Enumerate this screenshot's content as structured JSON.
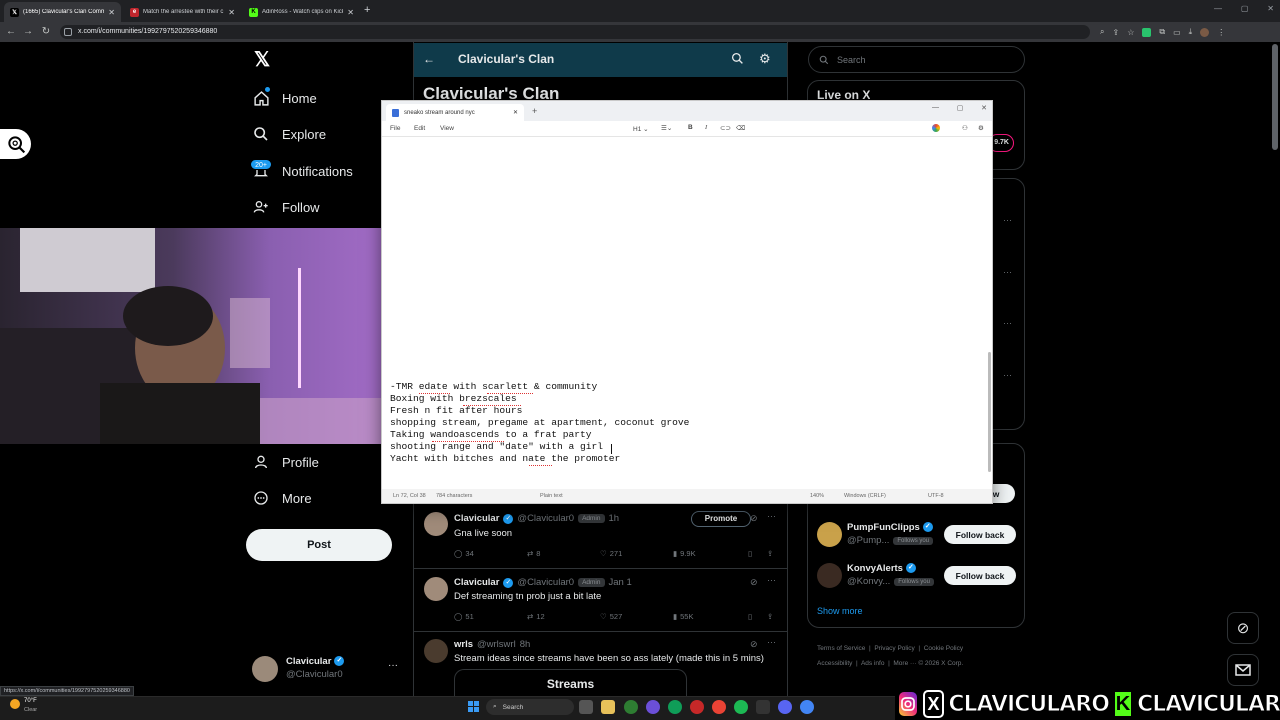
{
  "browser": {
    "tabs": [
      {
        "title": "(1665) Clavicular's Clan Commu",
        "icon": "X"
      },
      {
        "title": "Match the arrestee with their c",
        "icon": "e"
      },
      {
        "title": "AdinRoss - Watch clips on Kick",
        "icon": "K"
      }
    ],
    "url": "x.com/i/communities/1992797520259346880",
    "status_url": "https://x.com/i/communities/1992797520259346880"
  },
  "x_nav": {
    "items": [
      {
        "label": "Home",
        "icon": "home-icon"
      },
      {
        "label": "Explore",
        "icon": "search-icon"
      },
      {
        "label": "Notifications",
        "icon": "bell-icon",
        "badge": "20+"
      },
      {
        "label": "Follow",
        "icon": "follow-icon"
      },
      {
        "label": "Profile",
        "icon": "profile-icon"
      },
      {
        "label": "More",
        "icon": "more-icon"
      }
    ],
    "post_button": "Post",
    "account_name": "Clavicular",
    "account_handle": "@Clavicular0"
  },
  "community": {
    "header_title": "Clavicular's Clan",
    "big_title": "Clavicular's Clan"
  },
  "notepad": {
    "tab_title": "sneako stream around nyc",
    "menu": [
      "File",
      "Edit",
      "View"
    ],
    "heading_select": "H1",
    "lines": [
      "-TMR edate with scarlett & community",
      "Boxing with brezscales",
      "Fresh n fit after hours",
      "shopping stream, pregame at apartment, coconut grove",
      "Taking wandoascends to a frat party",
      "shooting range and \"date\" with a girl",
      "Yacht with bitches and nate the promoter"
    ],
    "status": {
      "position": "Ln 72, Col 38",
      "chars": "784 characters",
      "format": "Plain text",
      "zoom": "140%",
      "line_ending": "Windows (CRLF)",
      "encoding": "UTF-8"
    }
  },
  "posts": [
    {
      "name": "Clavicular",
      "handle": "@Clavicular0",
      "badge": "Admin",
      "time": "1h",
      "text": "Gna live soon",
      "replies": "34",
      "reposts": "8",
      "likes": "271",
      "views": "9.9K",
      "promote": "Promote"
    },
    {
      "name": "Clavicular",
      "handle": "@Clavicular0",
      "badge": "Admin",
      "time": "Jan 1",
      "text": "Def streaming tn prob just a bit late",
      "replies": "51",
      "reposts": "12",
      "likes": "527",
      "views": "55K"
    },
    {
      "name": "wrls",
      "handle": "@wrlswrl",
      "time": "8h",
      "text": "Stream ideas since streams have been so ass lately (made this in 5 mins)",
      "card_title": "Streams"
    }
  ],
  "right": {
    "search_placeholder": "Search",
    "live_title": "Live on X",
    "live_count": "9.7K",
    "follow_partial": "ow",
    "who_to_follow": [
      {
        "name": "PumpFunClipps",
        "handle": "@Pump...",
        "follows": "Follows you",
        "button": "Follow back"
      },
      {
        "name": "KonvyAlerts",
        "handle": "@Konvy...",
        "follows": "Follows you",
        "button": "Follow back"
      }
    ],
    "show_more": "Show more",
    "footer": [
      "Terms of Service",
      "Privacy Policy",
      "Cookie Policy",
      "Accessibility",
      "Ads info",
      "More ···",
      "© 2026 X Corp."
    ]
  },
  "taskbar": {
    "weather_temp": "70°F",
    "weather_desc": "Clear",
    "search": "Search"
  },
  "overlay": {
    "name1": "CLAVICULARO",
    "name2": "CLAVICULAR"
  }
}
